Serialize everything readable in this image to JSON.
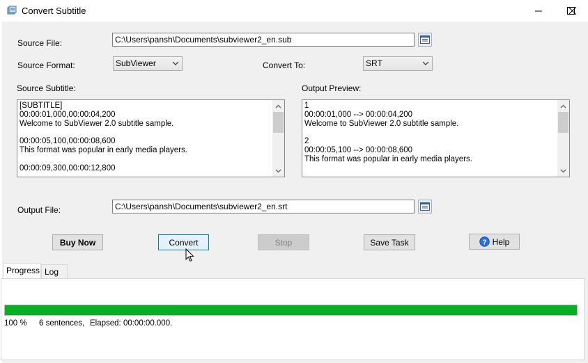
{
  "window": {
    "title": "Convert Subtitle"
  },
  "source_file": {
    "label": "Source File:",
    "value": "C:\\Users\\pansh\\Documents\\subviewer2_en.sub"
  },
  "source_format": {
    "label": "Source Format:",
    "value": "SubViewer"
  },
  "convert_to": {
    "label": "Convert To:",
    "value": "SRT"
  },
  "source_subtitle": {
    "label": "Source Subtitle:",
    "text": "[SUBTITLE]\n00:00:01,000,00:00:04,200\nWelcome to SubViewer 2.0 subtitle sample.\n\n00:00:05,100,00:00:08,600\nThis format was popular in early media players.\n\n00:00:09,300,00:00:12,800"
  },
  "output_preview": {
    "label": "Output Preview:",
    "text": "1\n00:00:01,000 --> 00:00:04,200\nWelcome to SubViewer 2.0 subtitle sample.\n\n2\n00:00:05,100 --> 00:00:08,600\nThis format was popular in early media players."
  },
  "output_file": {
    "label": "Output File:",
    "value": "C:\\Users\\pansh\\Documents\\subviewer2_en.srt"
  },
  "buttons": {
    "buy_now": "Buy Now",
    "convert": "Convert",
    "stop": "Stop",
    "save_task": "Save Task",
    "help": "Help"
  },
  "tabs": {
    "progress": "Progress",
    "log": "Log"
  },
  "progress": {
    "percent_text": "100 %",
    "fraction": 1.0,
    "sentences": "6 sentences,",
    "elapsed": "Elapsed: 00:00:00.000."
  },
  "colors": {
    "progress_fill": "#06b025",
    "help_icon": "#2a6fdb"
  }
}
